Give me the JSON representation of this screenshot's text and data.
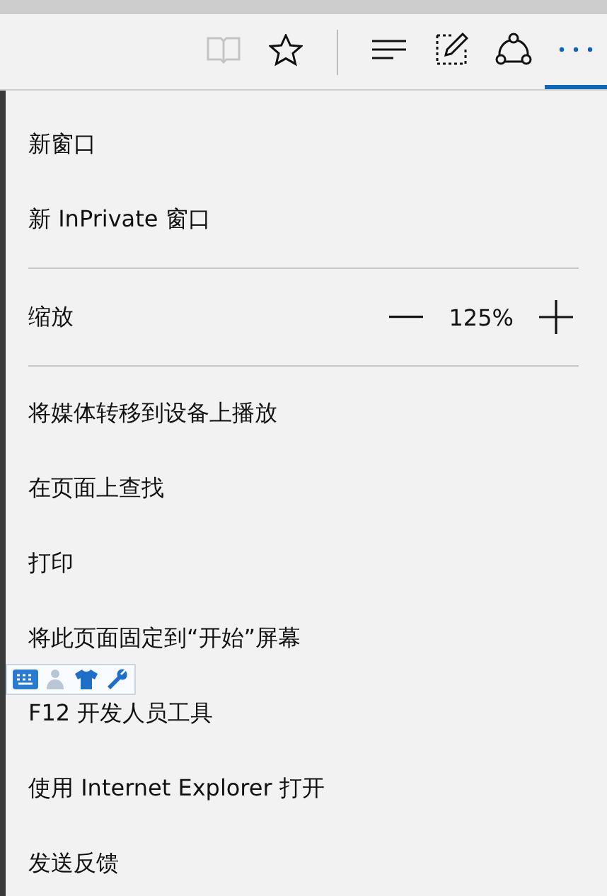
{
  "toolbar": {
    "buttons": [
      {
        "kind": "reading",
        "disabled": true,
        "selected": false
      },
      {
        "kind": "favorite",
        "disabled": false,
        "selected": false
      },
      {
        "kind": "separator"
      },
      {
        "kind": "hub",
        "disabled": false,
        "selected": false
      },
      {
        "kind": "note",
        "disabled": false,
        "selected": false
      },
      {
        "kind": "share",
        "disabled": false,
        "selected": false
      },
      {
        "kind": "more",
        "disabled": false,
        "selected": true
      }
    ]
  },
  "menu": {
    "items": [
      {
        "kind": "item",
        "label": "新窗口"
      },
      {
        "kind": "item",
        "label": "新 InPrivate 窗口"
      },
      {
        "kind": "divider"
      },
      {
        "kind": "zoom",
        "label": "缩放",
        "value": "125%"
      },
      {
        "kind": "divider"
      },
      {
        "kind": "item",
        "label": "将媒体转移到设备上播放"
      },
      {
        "kind": "item",
        "label": "在页面上查找"
      },
      {
        "kind": "item",
        "label": "打印"
      },
      {
        "kind": "item",
        "label": "将此页面固定到“开始”屏幕"
      },
      {
        "kind": "item",
        "label": "F12 开发人员工具"
      },
      {
        "kind": "item",
        "label": "使用 Internet Explorer 打开"
      },
      {
        "kind": "item",
        "label": "发送反馈"
      }
    ]
  }
}
